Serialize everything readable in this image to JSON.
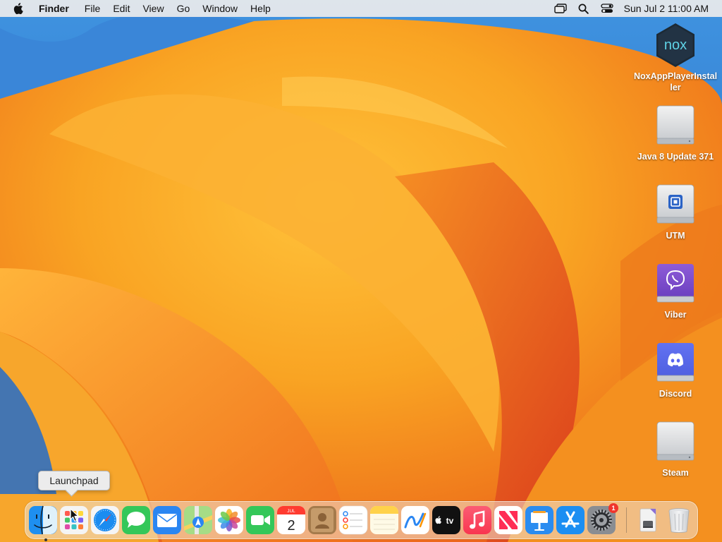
{
  "menubar": {
    "app_name": "Finder",
    "menus": [
      "File",
      "Edit",
      "View",
      "Go",
      "Window",
      "Help"
    ],
    "status_icons": [
      "screen-mirroring-icon",
      "search-icon",
      "control-center-icon"
    ],
    "datetime": "Sun Jul 2  11:00 AM"
  },
  "desktop_icons": [
    {
      "label": "NoxAppPlayerInstaller",
      "icon": "nox-installer-icon"
    },
    {
      "label": "Java 8 Update 371",
      "icon": "disk-image-icon"
    },
    {
      "label": "UTM",
      "icon": "utm-disk-icon"
    },
    {
      "label": "Viber",
      "icon": "viber-disk-icon"
    },
    {
      "label": "Discord",
      "icon": "discord-disk-icon"
    },
    {
      "label": "Steam",
      "icon": "disk-image-icon"
    }
  ],
  "tooltip": {
    "text": "Launchpad"
  },
  "calendar_icon": {
    "month": "JUL",
    "day": "2"
  },
  "appletv_icon": {
    "label": "tv"
  },
  "dock": {
    "apps": [
      "Finder",
      "Launchpad",
      "Safari",
      "Messages",
      "Mail",
      "Maps",
      "Photos",
      "FaceTime",
      "Calendar",
      "Contacts",
      "Reminders",
      "Notes",
      "Freeform",
      "TV",
      "Music",
      "News",
      "Keynote",
      "App Store",
      "System Settings",
      "Downloads",
      "Trash"
    ],
    "system_settings_badge": "1"
  },
  "colors": {
    "wallpaper_orange": "#f39a1e",
    "wallpaper_red": "#e5452a",
    "wallpaper_blue": "#2e6fc2",
    "menubar_bg": "#ececec",
    "badge_red": "#f0352c"
  }
}
